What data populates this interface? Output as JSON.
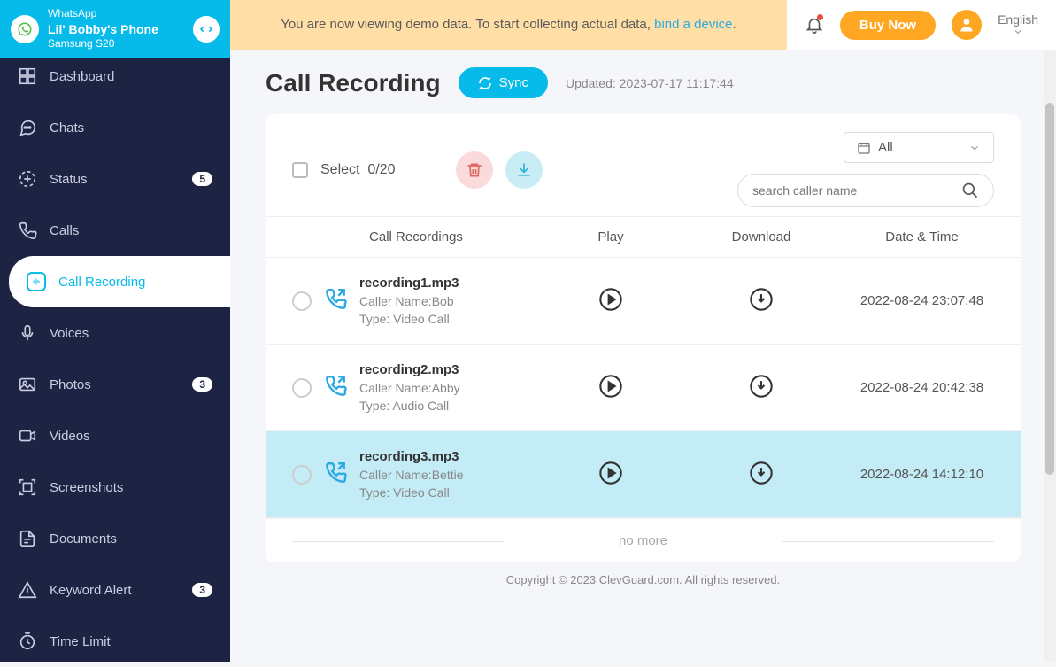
{
  "device": {
    "app": "WhatsApp",
    "name": "Lil' Bobby's Phone",
    "model": "Samsung S20"
  },
  "banner": {
    "prefix": "You are now viewing demo data. To start collecting actual data, ",
    "link": "bind a device",
    "suffix": "."
  },
  "topbar": {
    "buy": "Buy Now",
    "language": "English"
  },
  "sidebar": {
    "items": [
      {
        "label": "Dashboard",
        "badge": null
      },
      {
        "label": "Chats",
        "badge": null
      },
      {
        "label": "Status",
        "badge": "5"
      },
      {
        "label": "Calls",
        "badge": null
      },
      {
        "label": "Call Recording",
        "badge": null,
        "active": true
      },
      {
        "label": "Voices",
        "badge": null
      },
      {
        "label": "Photos",
        "badge": "3"
      },
      {
        "label": "Videos",
        "badge": null
      },
      {
        "label": "Screenshots",
        "badge": null
      },
      {
        "label": "Documents",
        "badge": null
      },
      {
        "label": "Keyword Alert",
        "badge": "3"
      },
      {
        "label": "Time Limit",
        "badge": null
      }
    ]
  },
  "page": {
    "title": "Call Recording",
    "sync": "Sync",
    "updated": "Updated: 2023-07-17 11:17:44"
  },
  "toolbar": {
    "select_label": "Select",
    "select_count": "0/20",
    "filter_value": "All",
    "search_placeholder": "search caller name"
  },
  "table": {
    "headers": {
      "recordings": "Call Recordings",
      "play": "Play",
      "download": "Download",
      "date": "Date & Time"
    },
    "rows": [
      {
        "file": "recording1.mp3",
        "caller_label": "Caller Name:",
        "caller": "Bob",
        "type_label": "Type:",
        "type": "Video Call",
        "date": "2022-08-24 23:07:48",
        "highlight": false
      },
      {
        "file": "recording2.mp3",
        "caller_label": "Caller Name:",
        "caller": "Abby",
        "type_label": "Type:",
        "type": "Audio Call",
        "date": "2022-08-24 20:42:38",
        "highlight": false
      },
      {
        "file": "recording3.mp3",
        "caller_label": "Caller Name:",
        "caller": "Bettie",
        "type_label": "Type:",
        "type": "Video Call",
        "date": "2022-08-24 14:12:10",
        "highlight": true
      }
    ],
    "no_more": "no more"
  },
  "footer": "Copyright © 2023 ClevGuard.com. All rights reserved."
}
